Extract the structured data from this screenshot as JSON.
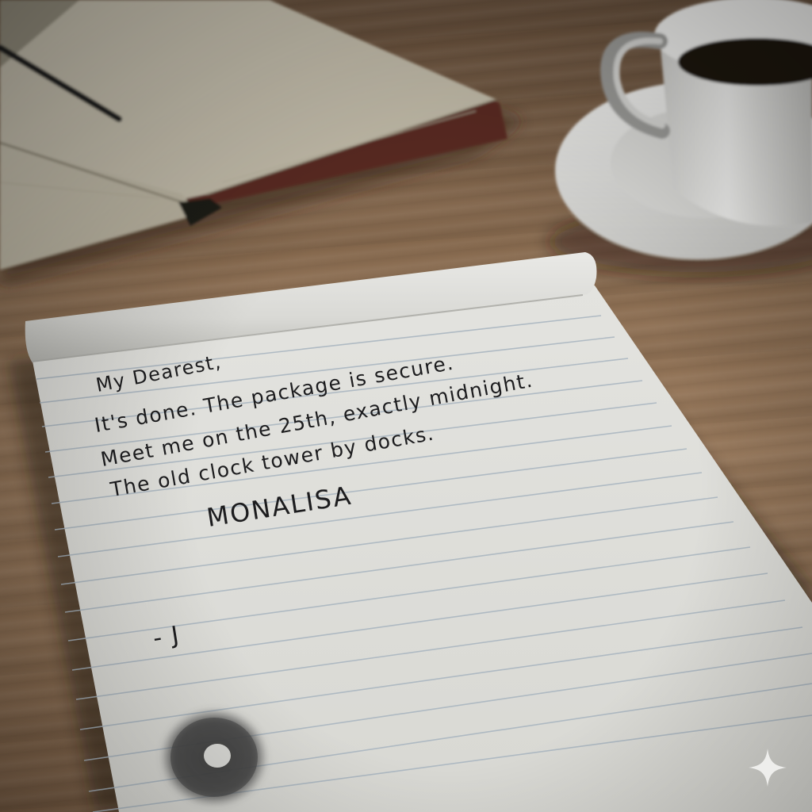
{
  "note": {
    "greeting": "My Dearest,",
    "line1": "It's done. The package is secure.",
    "line2": "Meet me on the 25th, exactly midnight.",
    "line3": "The old clock tower by docks.",
    "stamp": "MONALISA",
    "signature": "- J"
  },
  "colors": {
    "desk": "#8a6d52",
    "paper": "#e9e8e3",
    "ink": "#1c1c1e",
    "rule_lines": "#aab8c2",
    "book_pages": "#d8d2c0",
    "cup": "#e6e6e4",
    "coffee": "#1e140d"
  },
  "icons": {
    "watermark": "sparkle-icon"
  }
}
